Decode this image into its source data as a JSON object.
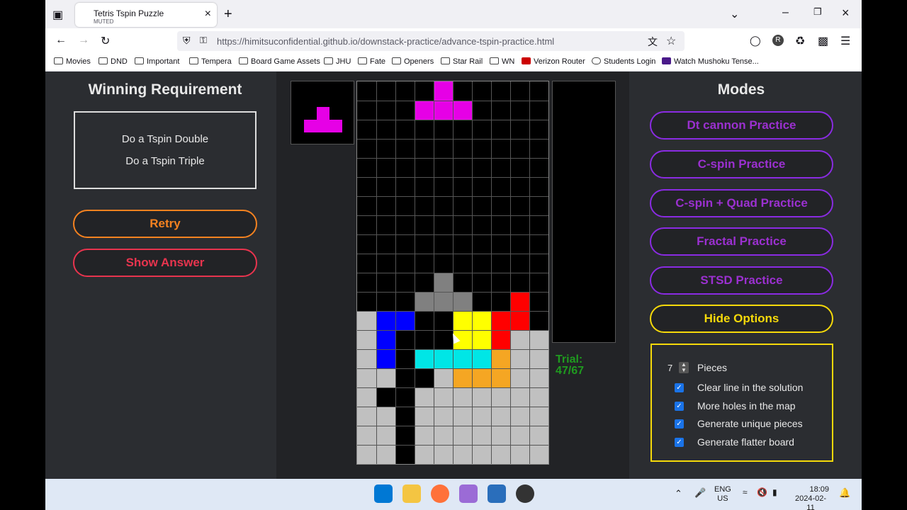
{
  "browser": {
    "tab_title": "Tetris Tspin Puzzle",
    "tab_subtitle": "MUTED",
    "url": "https://himitsuconfidential.github.io/downstack-practice/advance-tspin-practice.html",
    "bookmarks": [
      "Movies",
      "DND",
      "Important",
      "Tempera",
      "Board Game Assets",
      "JHU",
      "Fate",
      "Openers",
      "Star Rail",
      "WN",
      "Verizon Router",
      "Students Login",
      "Watch Mushoku Tense..."
    ]
  },
  "left": {
    "heading": "Winning Requirement",
    "requirements": [
      "Do a Tspin Double",
      "Do a Tspin Triple"
    ],
    "retry_label": "Retry",
    "show_answer_label": "Show Answer"
  },
  "center": {
    "trial_label": "Trial:",
    "trial_value": "47/67"
  },
  "right": {
    "heading": "Modes",
    "modes": [
      "Dt cannon Practice",
      "C-spin Practice",
      "C-spin + Quad Practice",
      "Fractal Practice",
      "STSD Practice"
    ],
    "hide_options_label": "Hide Options",
    "pieces_value": "7",
    "pieces_label": "Pieces",
    "options": [
      "Clear line in the solution",
      "More holes in the map",
      "Generate unique pieces",
      "Generate flatter board"
    ]
  },
  "taskbar": {
    "lang_1": "ENG",
    "lang_2": "US",
    "time": "18:09",
    "date": "2024-02-11"
  },
  "colors": {
    "magenta": "#e600e6",
    "blue": "#0000ff",
    "yellow": "#ffff00",
    "red": "#ff0000",
    "cyan": "#00e6e6",
    "orange": "#f5a623",
    "gray_piece": "#808080",
    "garbage": "#c0c0c0"
  }
}
